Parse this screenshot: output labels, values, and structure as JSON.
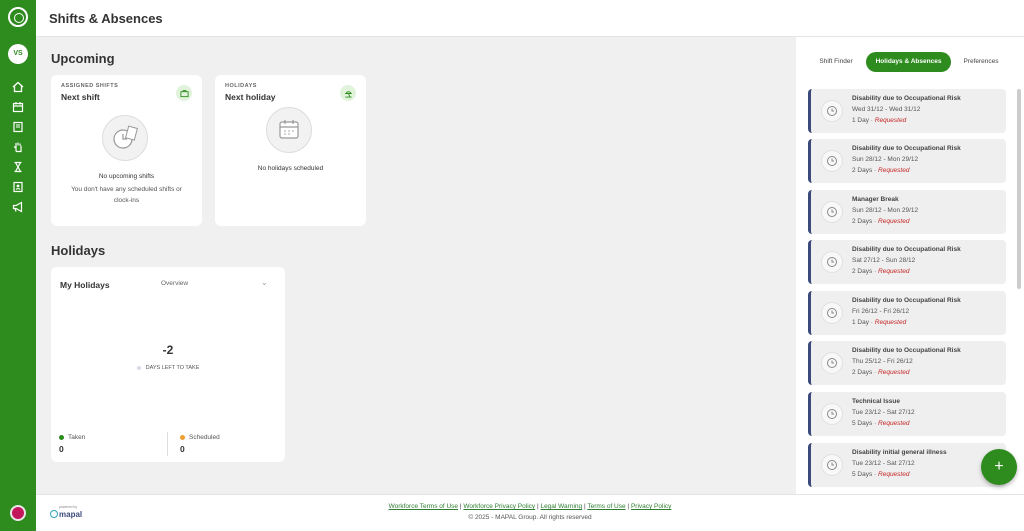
{
  "header": {
    "title": "Shifts & Absences"
  },
  "user": {
    "initials": "VS"
  },
  "upcoming": {
    "section_title": "Upcoming",
    "shift_card": {
      "eyebrow": "ASSIGNED SHIFTS",
      "title": "Next shift",
      "empty_title": "No upcoming shifts",
      "empty_text": "You don't have any scheduled shifts or clock-ins"
    },
    "holiday_card": {
      "eyebrow": "HOLIDAYS",
      "title": "Next holiday",
      "empty_title": "No holidays scheduled"
    }
  },
  "holidays": {
    "section_title": "Holidays",
    "card_title": "My Holidays",
    "select_value": "Overview",
    "days_left": "-2",
    "days_left_label": "DAYS LEFT TO TAKE",
    "taken_label": "Taken",
    "taken_value": "0",
    "scheduled_label": "Scheduled",
    "scheduled_value": "0"
  },
  "panel": {
    "tabs": [
      {
        "label": "Shift Finder"
      },
      {
        "label": "Holidays & Absences"
      },
      {
        "label": "Preferences"
      }
    ],
    "requests": [
      {
        "title": "Disability due to Occupational Risk",
        "dates": "Wed 31/12 - Wed 31/12",
        "duration": "1 Day",
        "status": "Requested"
      },
      {
        "title": "Disability due to Occupational Risk",
        "dates": "Sun 28/12 - Mon 29/12",
        "duration": "2 Days",
        "status": "Requested"
      },
      {
        "title": "Manager Break",
        "dates": "Sun 28/12 - Mon 29/12",
        "duration": "2 Days",
        "status": "Requested"
      },
      {
        "title": "Disability due to Occupational Risk",
        "dates": "Sat 27/12 - Sun 28/12",
        "duration": "2 Days",
        "status": "Requested"
      },
      {
        "title": "Disability due to Occupational Risk",
        "dates": "Fri 26/12 - Fri 26/12",
        "duration": "1 Day",
        "status": "Requested"
      },
      {
        "title": "Disability due to Occupational Risk",
        "dates": "Thu 25/12 - Fri 26/12",
        "duration": "2 Days",
        "status": "Requested"
      },
      {
        "title": "Technical Issue",
        "dates": "Tue 23/12 - Sat 27/12",
        "duration": "5 Days",
        "status": "Requested"
      },
      {
        "title": "Disability initial general illness",
        "dates": "Tue 23/12 - Sat 27/12",
        "duration": "5 Days",
        "status": "Requested"
      }
    ],
    "fab_label": "+"
  },
  "footer": {
    "powered_by": "powered by",
    "brand": "mapal",
    "links": [
      "Workforce Terms of Use",
      "Workforce Privacy Policy",
      "Legal Warning",
      "Terms of Use",
      "Privacy Policy"
    ],
    "separator": " | ",
    "copyright": "© 2025 - MAPAL Group. All rights reserved"
  },
  "colors": {
    "accent": "#2e8b1e",
    "status_requested": "#c62828",
    "request_border": "#3b4a7a"
  },
  "icons": {
    "sidebar": [
      "home-icon",
      "calendar-icon",
      "book-icon",
      "hand-icon",
      "hourglass-icon",
      "contacts-icon",
      "megaphone-icon"
    ]
  }
}
